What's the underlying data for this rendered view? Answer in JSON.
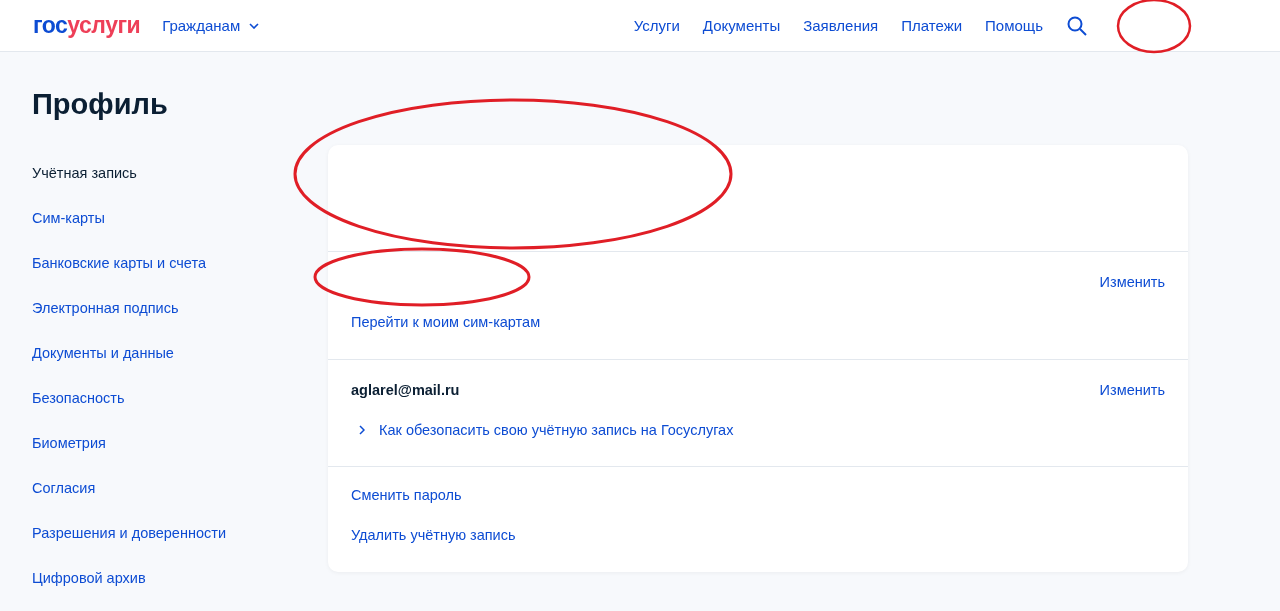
{
  "header": {
    "logo": {
      "part_1": "гос",
      "part_2": "услуги"
    },
    "audience": "Гражданам",
    "nav": [
      "Услуги",
      "Документы",
      "Заявления",
      "Платежи",
      "Помощь"
    ],
    "user_redacted": true
  },
  "page_title": "Профиль",
  "sidebar": {
    "items": [
      {
        "label": "Учётная запись",
        "selected": true
      },
      {
        "label": "Сим-карты",
        "selected": false
      },
      {
        "label": "Банковские карты и счета",
        "selected": false
      },
      {
        "label": "Электронная подпись",
        "selected": false
      },
      {
        "label": "Документы и данные",
        "selected": false
      },
      {
        "label": "Безопасность",
        "selected": false
      },
      {
        "label": "Биометрия",
        "selected": false
      },
      {
        "label": "Согласия",
        "selected": false
      },
      {
        "label": "Разрешения и доверенности",
        "selected": false
      },
      {
        "label": "Цифровой архив",
        "selected": false
      }
    ]
  },
  "card": {
    "name_redacted": true,
    "phone": {
      "redacted": true,
      "edit": "Изменить",
      "link": "Перейти к моим сим-картам"
    },
    "email": {
      "value": "aglarel@mail.ru",
      "edit": "Изменить",
      "tip": "Как обезопасить свою учётную запись на Госуслугах"
    },
    "actions": [
      "Сменить пароль",
      "Удалить учётную запись"
    ]
  }
}
